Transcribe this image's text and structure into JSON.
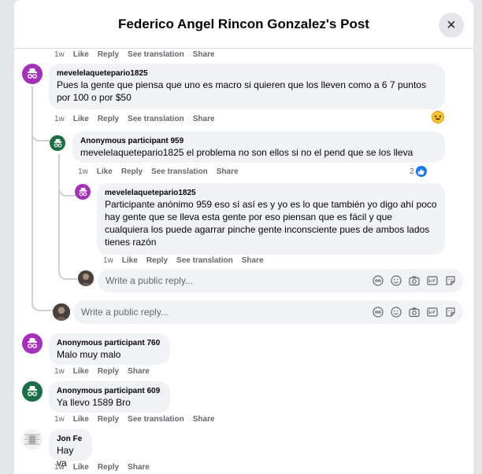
{
  "header": {
    "title": "Federico Angel Rincon Gonzalez's Post",
    "close_icon": "×"
  },
  "action_labels": {
    "like": "Like",
    "reply": "Reply",
    "see_translation": "See translation",
    "share": "Share"
  },
  "reply_placeholder": "Write a public reply...",
  "top_meta": {
    "time": "1w"
  },
  "comments": [
    {
      "name": "mevelelaquetepario1825",
      "text": "Pues la gente que piensa que uno es macro si quieren que los lleven como a 6 7 puntos por 100 o por $50",
      "time": "1w",
      "reaction": "haha"
    },
    {
      "name": "Anonymous participant 959",
      "text": "mevelelaquetepario1825 el problema no son ellos si no el pend que se los lleva",
      "time": "1w",
      "likes": "2"
    },
    {
      "name": "mevelelaquetepario1825",
      "text": "Participante anónimo 959 eso sí así es y yo es lo que también yo digo ahí poco hay gente que se lleva esta gente por eso piensan que es fácil y que cualquiera los puede agarrar pinche gente inconsciente pues de ambos lados tienes razón",
      "time": "1w"
    },
    {
      "name": "Anonymous participant 760",
      "text": "Malo muy malo",
      "time": "1w"
    },
    {
      "name": "Anonymous participant 609",
      "text": "Ya llevo 1589 Bro",
      "time": "1w"
    },
    {
      "name": "Jon Fe",
      "text": "Hay va",
      "time": "1w"
    }
  ],
  "colors": {
    "anon_purple": "#a430bb",
    "anon_green": "#1b6f44",
    "like_blue": "#1877f2",
    "bubble_bg": "#f0f2f5",
    "meta_gray": "#65676b"
  }
}
